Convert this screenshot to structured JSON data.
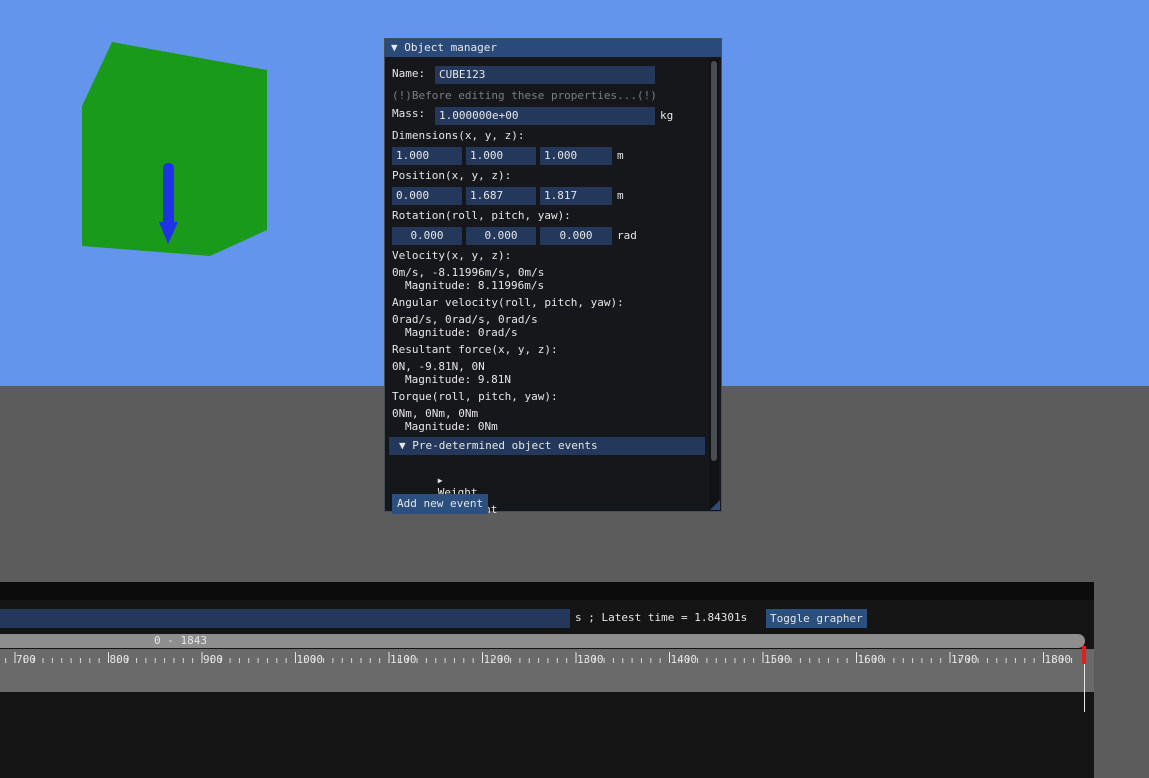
{
  "colors": {
    "sky": "#6495ED",
    "ground": "#5c5c5c",
    "cube_face": "#1a9a1a",
    "arrow": "#1e32e6",
    "window_bg": "#15171b",
    "title_bg": "#294a7a",
    "field_bg": "#23385a",
    "button_bg": "#2b4f7e",
    "marker": "#e02020"
  },
  "object_manager": {
    "title": "Object manager",
    "collapse_glyph": "▼",
    "name_label": "Name:",
    "name_value": "CUBE123",
    "warning": "(!)Before editing these properties...(!)",
    "mass_label": "Mass:",
    "mass_value": "1.000000e+00",
    "mass_unit": "kg",
    "dimensions_label": "Dimensions(x, y, z):",
    "dimensions": [
      "1.000",
      "1.000",
      "1.000"
    ],
    "dimensions_unit": "m",
    "position_label": "Position(x, y, z):",
    "position": [
      "0.000",
      "1.687",
      "1.817"
    ],
    "position_unit": "m",
    "rotation_label": "Rotation(roll, pitch, yaw):",
    "rotation": [
      "0.000",
      "0.000",
      "0.000"
    ],
    "rotation_unit": "rad",
    "velocity_label": "Velocity(x, y, z):",
    "velocity_value": "0m/s, -8.11996m/s, 0m/s",
    "velocity_magnitude": "Magnitude: 8.11996m/s",
    "angular_velocity_label": "Angular velocity(roll, pitch, yaw):",
    "angular_velocity_value": "0rad/s, 0rad/s, 0rad/s",
    "angular_velocity_magnitude": "Magnitude: 0rad/s",
    "resultant_force_label": "Resultant force(x, y, z):",
    "resultant_force_value": "0N, -9.81N, 0N",
    "resultant_force_magnitude": "Magnitude: 9.81N",
    "torque_label": "Torque(roll, pitch, yaw):",
    "torque_value": "0Nm, 0Nm, 0Nm",
    "torque_magnitude": "Magnitude: 0Nm",
    "events_header": "Pre-determined object events",
    "events": [
      "Weight",
      "New event"
    ],
    "expand_glyph": "▶",
    "add_event_label": "Add new event"
  },
  "timeline": {
    "time_text": "s ; Latest time = 1.84301s",
    "toggle_grapher_label": "Toggle grapher",
    "range_label": "0 - 1843",
    "tick_labels": [
      "700",
      "800",
      "900",
      "1000",
      "1100",
      "1200",
      "1300",
      "1400",
      "1500",
      "1600",
      "1700",
      "1800"
    ]
  }
}
